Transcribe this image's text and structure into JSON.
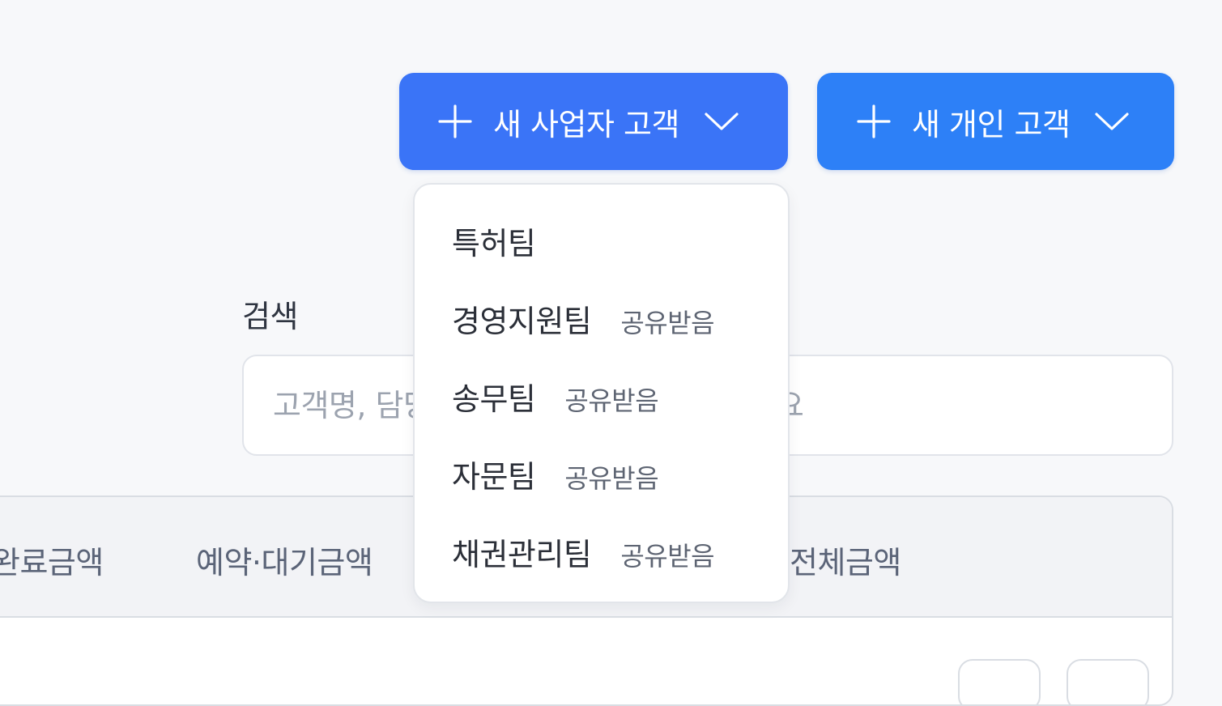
{
  "header": {
    "new_business_button": {
      "label": "새 사업자 고객",
      "plus_icon": "plus-icon",
      "chevron_icon": "chevron-down-icon"
    },
    "new_personal_button": {
      "label": "새 개인 고객",
      "plus_icon": "plus-icon",
      "chevron_icon": "chevron-down-icon"
    }
  },
  "search": {
    "label": "검색",
    "placeholder": "고객명, 담당자, 사건명 등으로 찾아보세요",
    "value": ""
  },
  "table": {
    "columns": [
      "완료금액",
      "예약·대기금액",
      "전체금액"
    ]
  },
  "dropdown": {
    "items": [
      {
        "team": "특허팀",
        "badge": ""
      },
      {
        "team": "경영지원팀",
        "badge": "공유받음"
      },
      {
        "team": "송무팀",
        "badge": "공유받음"
      },
      {
        "team": "자문팀",
        "badge": "공유받음"
      },
      {
        "team": "채권관리팀",
        "badge": "공유받음"
      }
    ]
  },
  "colors": {
    "primary": "#3a74f7",
    "primary_alt": "#2d80f7",
    "background": "#f7f8fa"
  }
}
